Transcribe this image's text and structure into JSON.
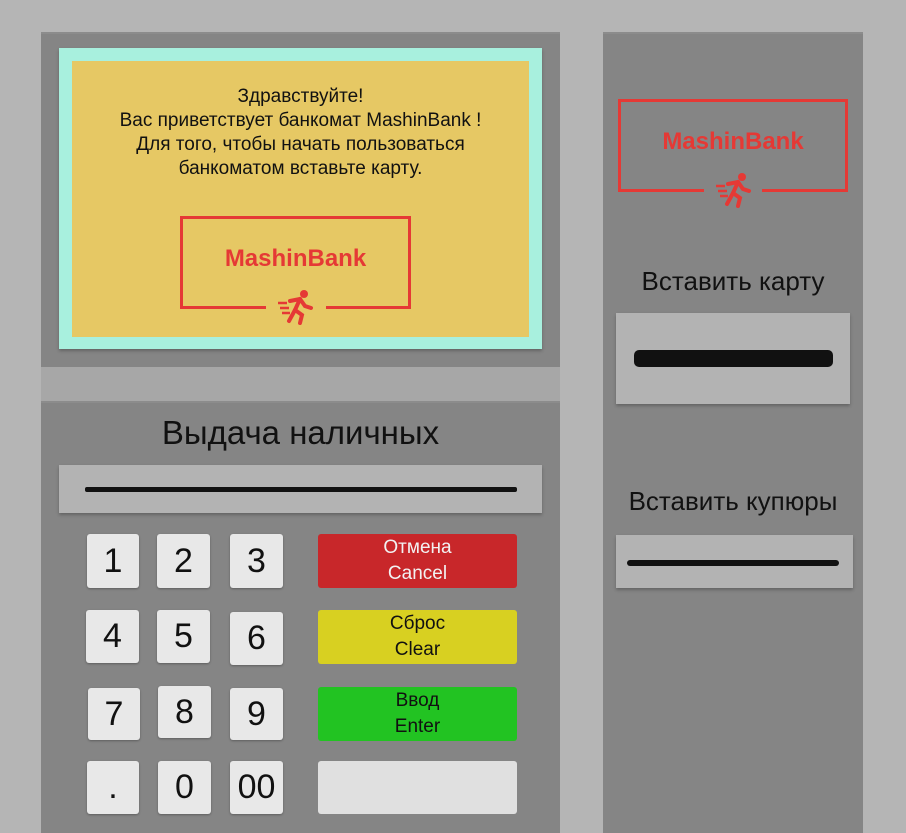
{
  "screen": {
    "greeting": "Здравствуйте!\nВас приветствует банкомат MashinBank !\nДля того, чтобы начать пользоваться\nбанкоматом вставьте карту.",
    "logo_text": "MashinBank",
    "logo_icon": "running-man-icon"
  },
  "cash_dispenser": {
    "label": "Выдача наличных"
  },
  "keypad": {
    "keys": [
      "1",
      "2",
      "3",
      "4",
      "5",
      "6",
      "7",
      "8",
      "9",
      ".",
      "0",
      "00"
    ]
  },
  "functions": {
    "cancel": "Отмена\nCancel",
    "clear": "Сброс\nClear",
    "enter": "Ввод\nEnter",
    "blank": ""
  },
  "side": {
    "logo_text": "MashinBank",
    "card_label": "Вставить карту",
    "bills_label": "Вставить купюры"
  },
  "colors": {
    "panel": "#858585",
    "screen_frame": "#a8f0de",
    "screen": "#e6c864",
    "brand_red": "#e53935",
    "cancel": "#c8272a",
    "clear": "#d8d021",
    "enter": "#22c322"
  }
}
